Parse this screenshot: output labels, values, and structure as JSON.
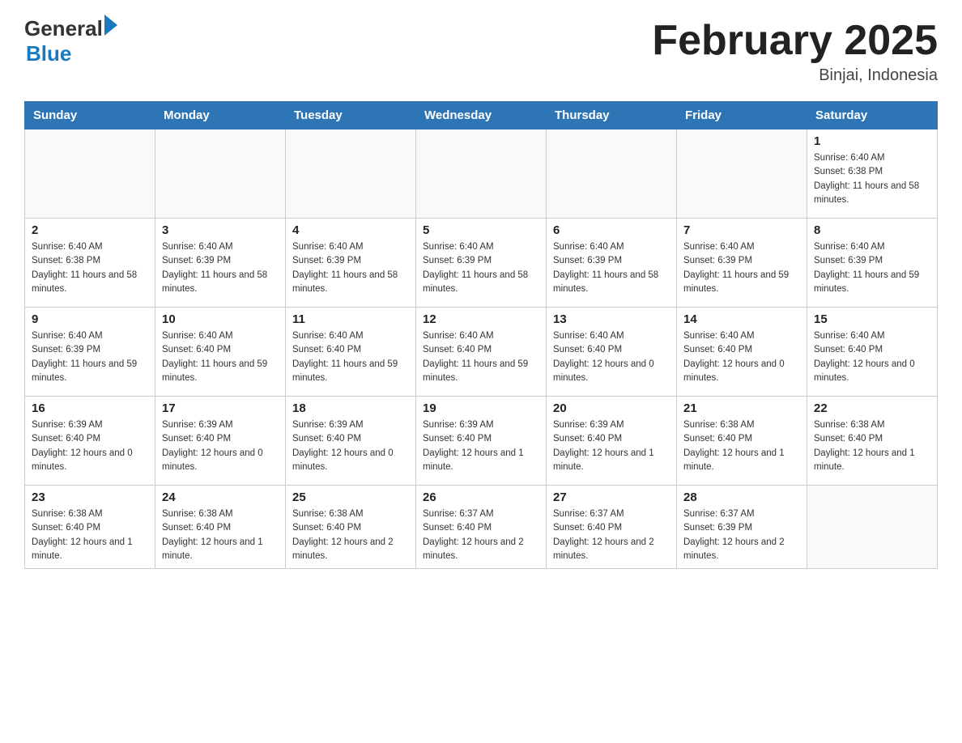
{
  "header": {
    "logo_general": "General",
    "logo_blue": "Blue",
    "title": "February 2025",
    "location": "Binjai, Indonesia"
  },
  "days_of_week": [
    "Sunday",
    "Monday",
    "Tuesday",
    "Wednesday",
    "Thursday",
    "Friday",
    "Saturday"
  ],
  "weeks": [
    [
      {
        "day": "",
        "info": ""
      },
      {
        "day": "",
        "info": ""
      },
      {
        "day": "",
        "info": ""
      },
      {
        "day": "",
        "info": ""
      },
      {
        "day": "",
        "info": ""
      },
      {
        "day": "",
        "info": ""
      },
      {
        "day": "1",
        "info": "Sunrise: 6:40 AM\nSunset: 6:38 PM\nDaylight: 11 hours and 58 minutes."
      }
    ],
    [
      {
        "day": "2",
        "info": "Sunrise: 6:40 AM\nSunset: 6:38 PM\nDaylight: 11 hours and 58 minutes."
      },
      {
        "day": "3",
        "info": "Sunrise: 6:40 AM\nSunset: 6:39 PM\nDaylight: 11 hours and 58 minutes."
      },
      {
        "day": "4",
        "info": "Sunrise: 6:40 AM\nSunset: 6:39 PM\nDaylight: 11 hours and 58 minutes."
      },
      {
        "day": "5",
        "info": "Sunrise: 6:40 AM\nSunset: 6:39 PM\nDaylight: 11 hours and 58 minutes."
      },
      {
        "day": "6",
        "info": "Sunrise: 6:40 AM\nSunset: 6:39 PM\nDaylight: 11 hours and 58 minutes."
      },
      {
        "day": "7",
        "info": "Sunrise: 6:40 AM\nSunset: 6:39 PM\nDaylight: 11 hours and 59 minutes."
      },
      {
        "day": "8",
        "info": "Sunrise: 6:40 AM\nSunset: 6:39 PM\nDaylight: 11 hours and 59 minutes."
      }
    ],
    [
      {
        "day": "9",
        "info": "Sunrise: 6:40 AM\nSunset: 6:39 PM\nDaylight: 11 hours and 59 minutes."
      },
      {
        "day": "10",
        "info": "Sunrise: 6:40 AM\nSunset: 6:40 PM\nDaylight: 11 hours and 59 minutes."
      },
      {
        "day": "11",
        "info": "Sunrise: 6:40 AM\nSunset: 6:40 PM\nDaylight: 11 hours and 59 minutes."
      },
      {
        "day": "12",
        "info": "Sunrise: 6:40 AM\nSunset: 6:40 PM\nDaylight: 11 hours and 59 minutes."
      },
      {
        "day": "13",
        "info": "Sunrise: 6:40 AM\nSunset: 6:40 PM\nDaylight: 12 hours and 0 minutes."
      },
      {
        "day": "14",
        "info": "Sunrise: 6:40 AM\nSunset: 6:40 PM\nDaylight: 12 hours and 0 minutes."
      },
      {
        "day": "15",
        "info": "Sunrise: 6:40 AM\nSunset: 6:40 PM\nDaylight: 12 hours and 0 minutes."
      }
    ],
    [
      {
        "day": "16",
        "info": "Sunrise: 6:39 AM\nSunset: 6:40 PM\nDaylight: 12 hours and 0 minutes."
      },
      {
        "day": "17",
        "info": "Sunrise: 6:39 AM\nSunset: 6:40 PM\nDaylight: 12 hours and 0 minutes."
      },
      {
        "day": "18",
        "info": "Sunrise: 6:39 AM\nSunset: 6:40 PM\nDaylight: 12 hours and 0 minutes."
      },
      {
        "day": "19",
        "info": "Sunrise: 6:39 AM\nSunset: 6:40 PM\nDaylight: 12 hours and 1 minute."
      },
      {
        "day": "20",
        "info": "Sunrise: 6:39 AM\nSunset: 6:40 PM\nDaylight: 12 hours and 1 minute."
      },
      {
        "day": "21",
        "info": "Sunrise: 6:38 AM\nSunset: 6:40 PM\nDaylight: 12 hours and 1 minute."
      },
      {
        "day": "22",
        "info": "Sunrise: 6:38 AM\nSunset: 6:40 PM\nDaylight: 12 hours and 1 minute."
      }
    ],
    [
      {
        "day": "23",
        "info": "Sunrise: 6:38 AM\nSunset: 6:40 PM\nDaylight: 12 hours and 1 minute."
      },
      {
        "day": "24",
        "info": "Sunrise: 6:38 AM\nSunset: 6:40 PM\nDaylight: 12 hours and 1 minute."
      },
      {
        "day": "25",
        "info": "Sunrise: 6:38 AM\nSunset: 6:40 PM\nDaylight: 12 hours and 2 minutes."
      },
      {
        "day": "26",
        "info": "Sunrise: 6:37 AM\nSunset: 6:40 PM\nDaylight: 12 hours and 2 minutes."
      },
      {
        "day": "27",
        "info": "Sunrise: 6:37 AM\nSunset: 6:40 PM\nDaylight: 12 hours and 2 minutes."
      },
      {
        "day": "28",
        "info": "Sunrise: 6:37 AM\nSunset: 6:39 PM\nDaylight: 12 hours and 2 minutes."
      },
      {
        "day": "",
        "info": ""
      }
    ]
  ]
}
